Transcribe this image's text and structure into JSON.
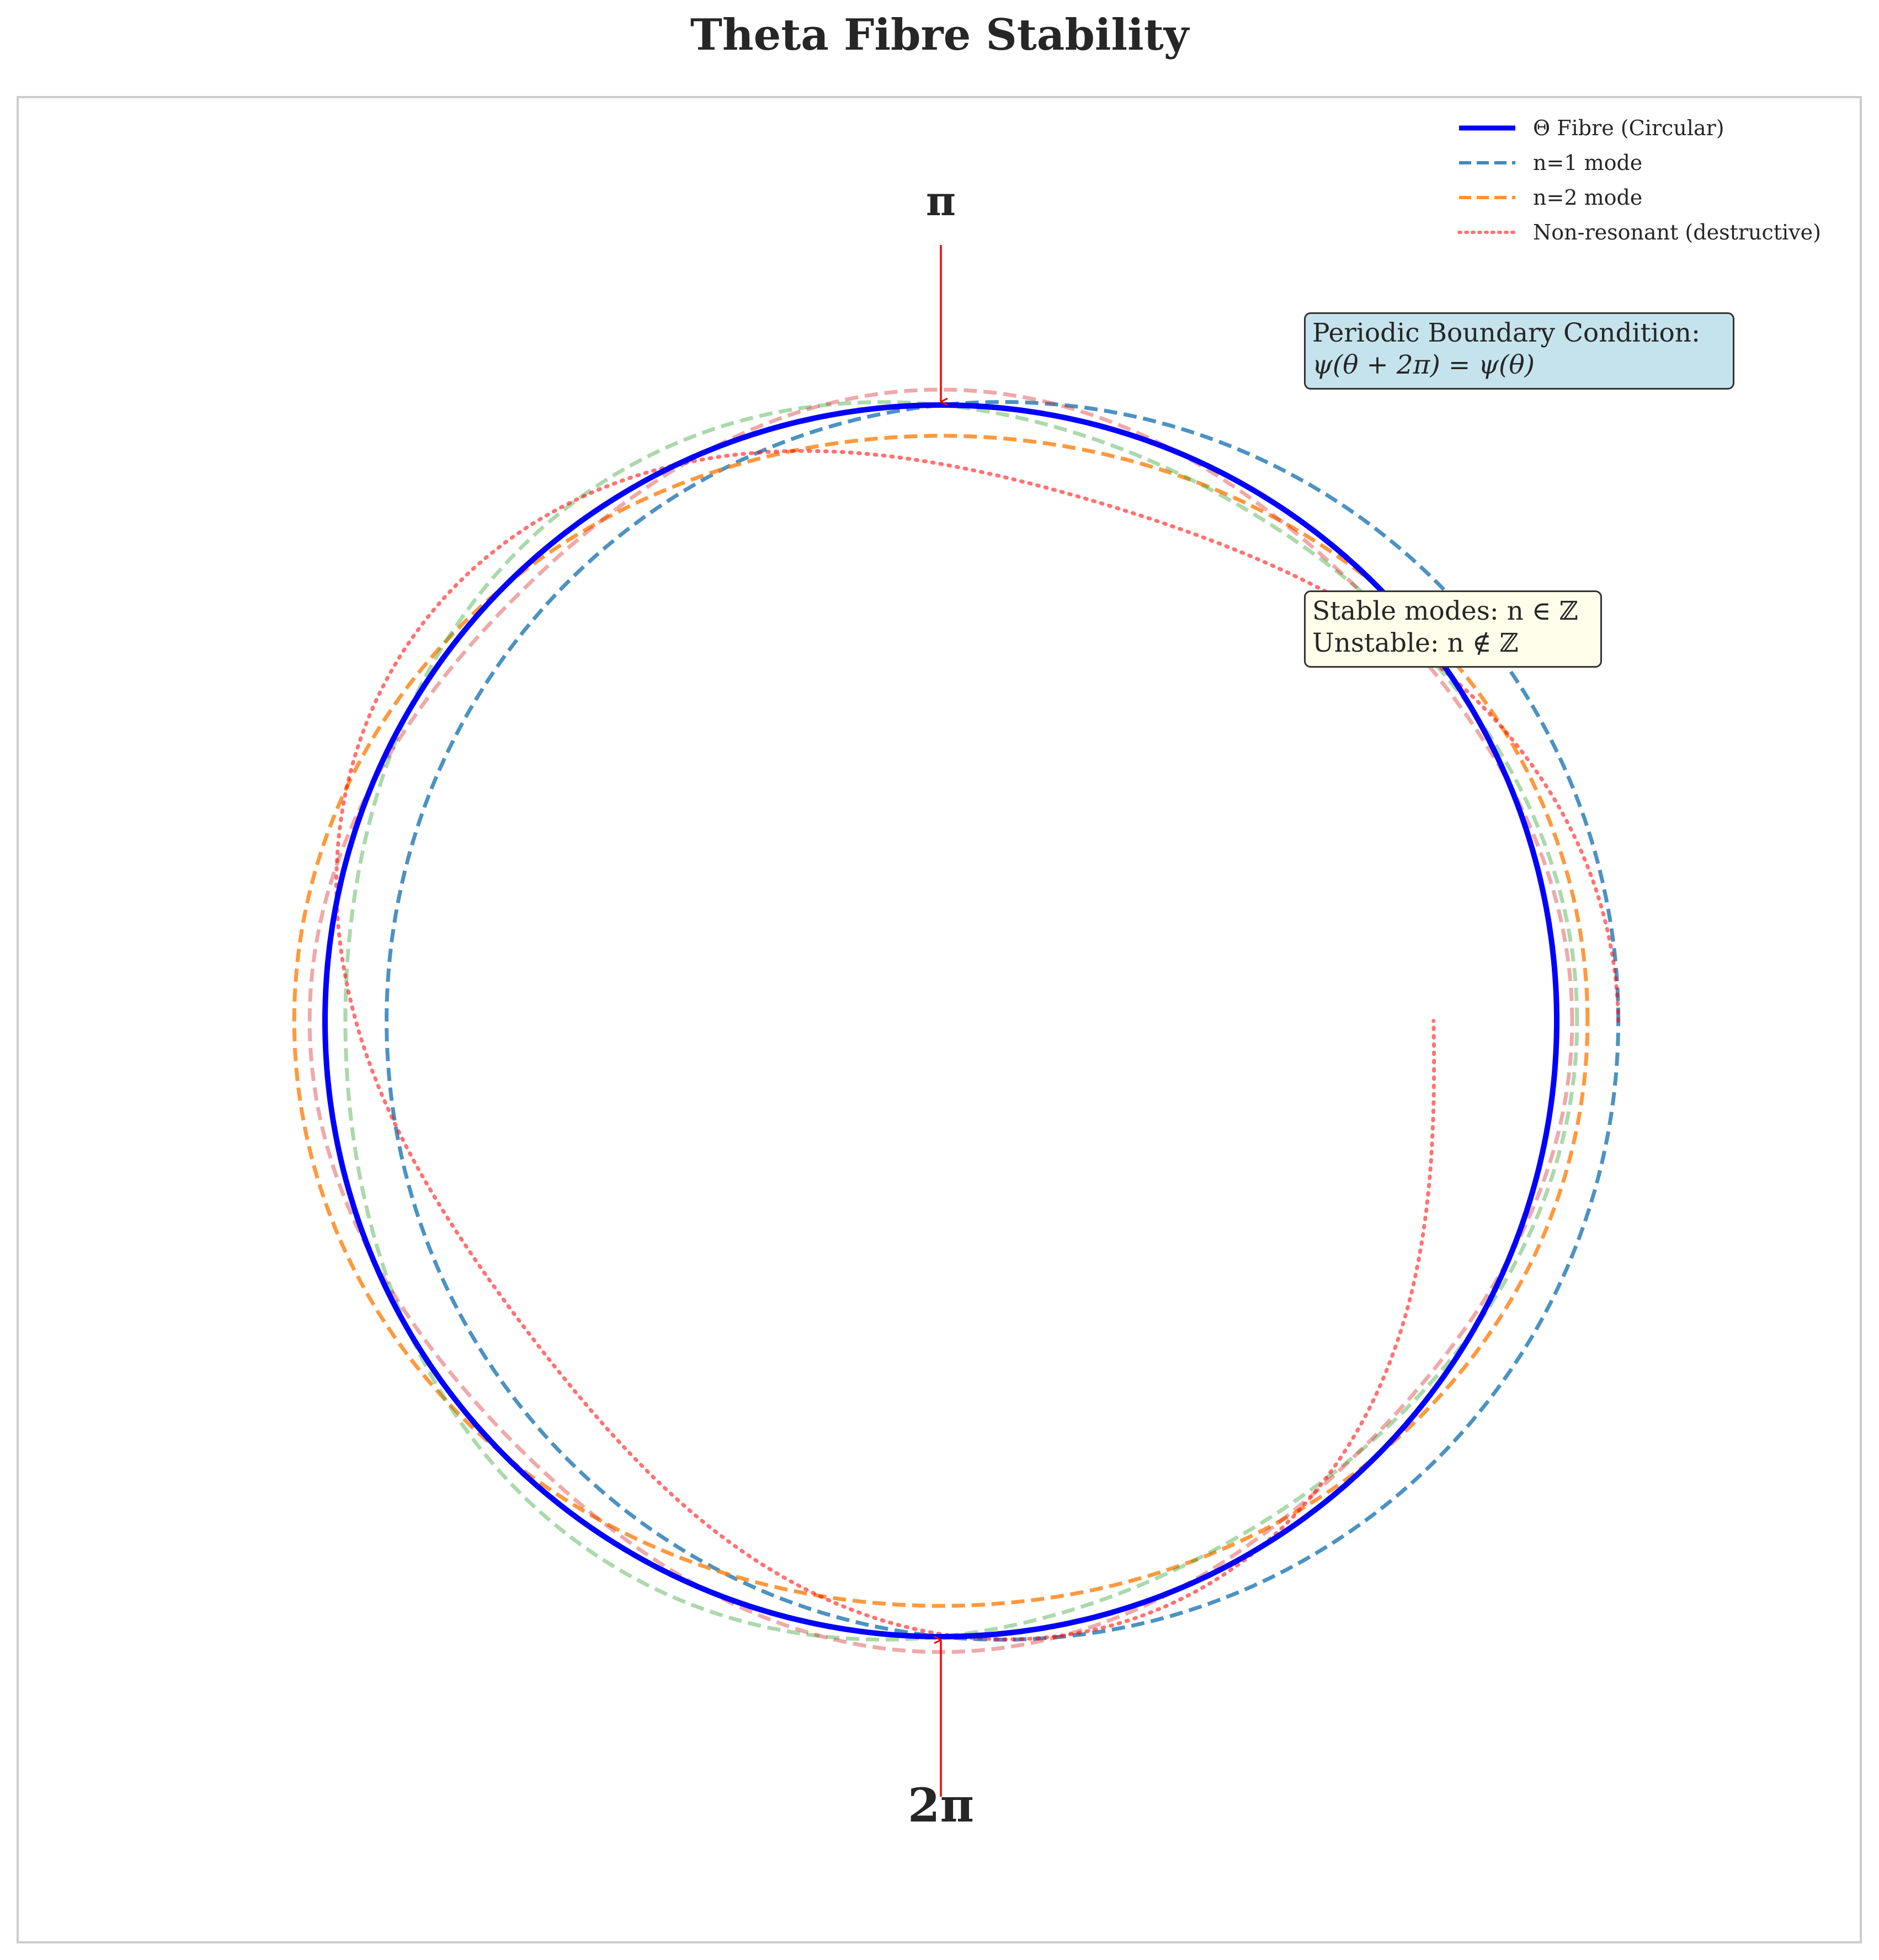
{
  "chart_data": {
    "type": "line",
    "title": "Theta Fibre Stability",
    "xlabel": "",
    "ylabel": "",
    "xlim": [
      -1.7,
      1.7
    ],
    "ylim": [
      -1.7,
      1.7
    ],
    "axes_visible": false,
    "grid": false,
    "legend_position": "top-right",
    "series": [
      {
        "name": "Θ Fibre (Circular)",
        "color": "#0000ff",
        "style": "solid",
        "radius": 1.0,
        "mode": 0,
        "amplitude": 0.0,
        "phase": 0.0,
        "sweep_turns": 1.0
      },
      {
        "name": "n=1 mode",
        "color": "#1f77b4",
        "style": "dashed",
        "radius": 1.0,
        "mode": 1,
        "amplitude": 0.1,
        "phase": 0.0,
        "sweep_turns": 1.0
      },
      {
        "name": "n=2 mode",
        "color": "#ff7f0e",
        "style": "dashed",
        "radius": 1.0,
        "mode": 2,
        "amplitude": 0.05,
        "phase": 0.0,
        "sweep_turns": 1.0
      },
      {
        "name": "",
        "color": "#2ca02c",
        "style": "dashed",
        "radius": 1.0,
        "mode": 3,
        "amplitude": 0.033,
        "phase": 0.0,
        "sweep_turns": 1.0,
        "alpha": 0.4
      },
      {
        "name": "",
        "color": "#d62728",
        "style": "dashed",
        "radius": 1.0,
        "mode": 4,
        "amplitude": 0.025,
        "phase": 0.0,
        "sweep_turns": 1.0,
        "alpha": 0.4
      },
      {
        "name": "Non-resonant (destructive)",
        "color": "#ff0000",
        "style": "dotted",
        "radius": 1.0,
        "mode": 2.5,
        "amplitude": 0.1,
        "phase": 0.0,
        "sweep_turns": 1.0,
        "radial_drift": -0.1,
        "alpha": 0.55
      }
    ],
    "annotations": [
      {
        "text": "π",
        "points_to": [
          0,
          1
        ],
        "label_at": [
          0,
          1.33
        ]
      },
      {
        "text": "2π",
        "points_to": [
          0,
          -1
        ],
        "label_at": [
          0,
          -1.33
        ]
      }
    ]
  },
  "legend": {
    "items": [
      {
        "label": "Θ Fibre (Circular)",
        "color": "#0000ff",
        "style": "solid"
      },
      {
        "label": "n=1 mode",
        "color": "#1f77b4",
        "style": "dashed"
      },
      {
        "label": "n=2 mode",
        "color": "#ff7f0e",
        "style": "dashed"
      },
      {
        "label": "Non-resonant (destructive)",
        "color": "#ff0000",
        "style": "dotted"
      }
    ]
  },
  "boxes": {
    "periodic": {
      "line1": "Periodic Boundary Condition:",
      "line2": "ψ(θ + 2π) = ψ(θ)",
      "color": "#add8e6"
    },
    "stable": {
      "line1": "Stable modes: n ∈ ℤ",
      "line2": "Unstable: n ∉ ℤ",
      "color": "#ffffe0"
    }
  },
  "annotation_labels": {
    "top": "π",
    "bottom": "2π"
  }
}
